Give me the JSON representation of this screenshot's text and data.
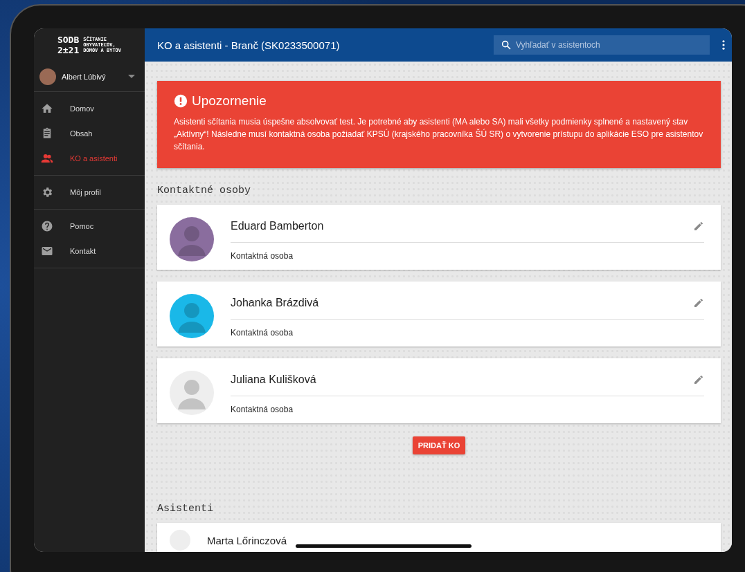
{
  "logo": {
    "mark_top": "SODB",
    "mark_bottom": "2±21",
    "caption_lines": [
      "SČÍTANIE",
      "OBYVATEĽOV,",
      "DOMOV A BYTOV"
    ]
  },
  "user": {
    "name": "Albert Lúbivý"
  },
  "nav_groups": [
    [
      {
        "label": "Domov",
        "kind": "home",
        "selected": false
      },
      {
        "label": "Obsah",
        "kind": "clipboard",
        "selected": false
      },
      {
        "label": "KO a asistenti",
        "kind": "people",
        "selected": true
      }
    ],
    [
      {
        "label": "Môj profil",
        "kind": "gear",
        "selected": false
      }
    ],
    [
      {
        "label": "Pomoc",
        "kind": "help",
        "selected": false
      },
      {
        "label": "Kontakt",
        "kind": "mail",
        "selected": false
      }
    ]
  ],
  "top_bar": {
    "title": "KO a asistenti - Branč (SK0233500071)",
    "search": {
      "placeholder": "Vyhľadať v asistentoch"
    }
  },
  "alert": {
    "title": "Upozornenie",
    "text": "Asistenti sčítania musia úspešne absolvovať test. Je potrebné aby asistenti (MA alebo SA) mali všetky podmienky splnené a nastavený stav „Aktívny“! Následne musí kontaktná osoba požiadať KPSÚ (krajského pracovníka ŠÚ SR) o vytvorenie prístupu do aplikácie ESO pre asistentov sčítania."
  },
  "contacts": {
    "heading": "Kontaktné osoby",
    "people": [
      {
        "name": "Eduard Bamberton",
        "role": "Kontaktná osoba",
        "color": "#8a6d9e"
      },
      {
        "name": "Johanka Brázdivá",
        "role": "Kontaktná osoba",
        "color": "#1ab8e8"
      },
      {
        "name": "Juliana Kulišková",
        "role": "Kontaktná osoba",
        "color": "#eeeeee"
      }
    ],
    "add_button": "PRIDAŤ KO"
  },
  "assistants": {
    "heading": "Asistenti",
    "people": [
      {
        "name": "Marta Lőrinczová"
      }
    ]
  }
}
